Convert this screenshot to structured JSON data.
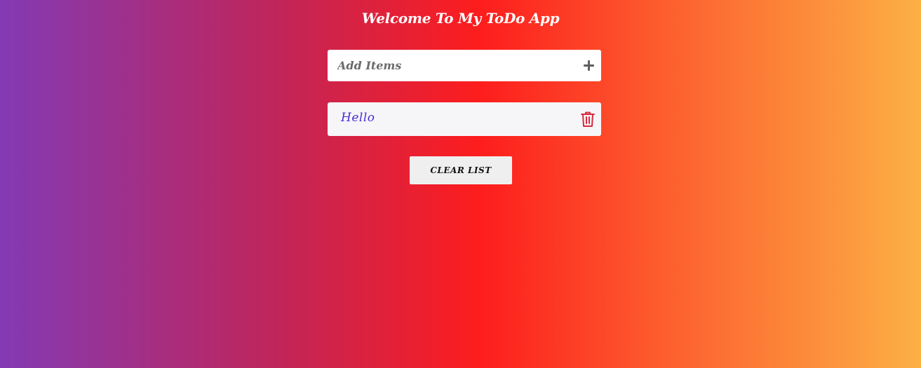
{
  "app": {
    "title": "Welcome To My ToDo App"
  },
  "input": {
    "placeholder": "Add Items",
    "value": "",
    "add_icon": "plus-icon"
  },
  "items": [
    {
      "text": "Hello",
      "delete_icon": "trash-icon"
    }
  ],
  "actions": {
    "clear_label": "CLEAR LIST"
  },
  "colors": {
    "gradient": [
      "#833ab4",
      "#fd1d1d",
      "#fcb045"
    ],
    "item_text": "#4a2bd0",
    "delete_icon": "#d8283c"
  }
}
